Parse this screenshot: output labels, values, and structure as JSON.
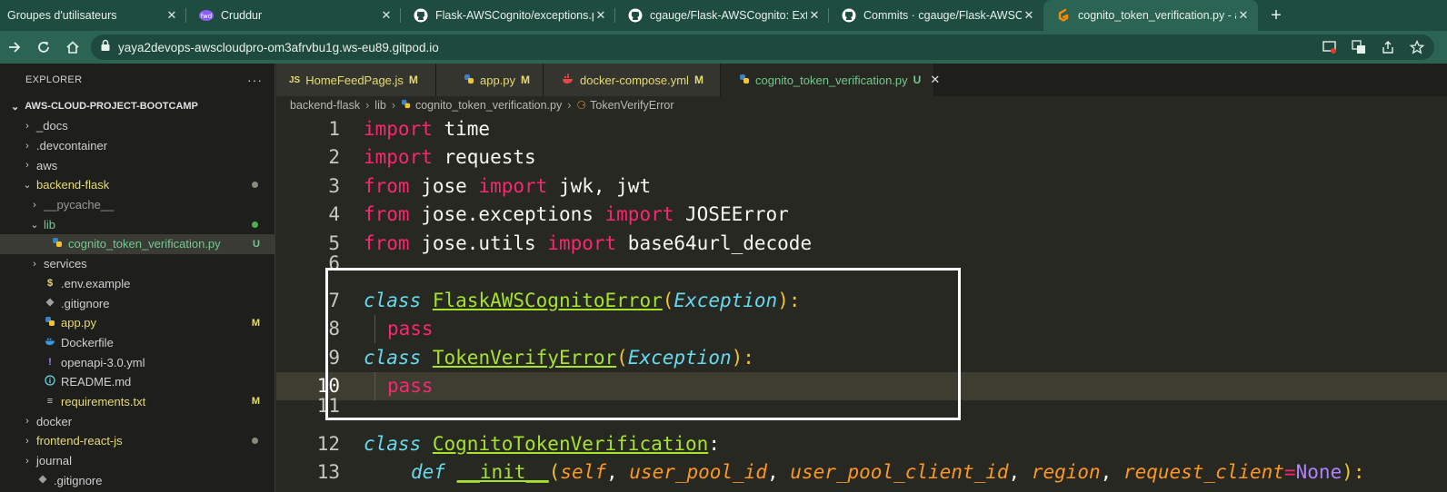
{
  "browser": {
    "tabs": [
      {
        "title": "Groupes d'utilisateurs",
        "icon": "none",
        "active": false
      },
      {
        "title": "Cruddur",
        "icon": "cruddur-icon",
        "active": false
      },
      {
        "title": "Flask-AWSCognito/exceptions.py",
        "icon": "github-icon",
        "active": false
      },
      {
        "title": "cgauge/Flask-AWSCognito: Exten",
        "icon": "github-icon",
        "active": false
      },
      {
        "title": "Commits · cgauge/Flask-AWSCog",
        "icon": "github-icon",
        "active": false
      },
      {
        "title": "cognito_token_verification.py - aw",
        "icon": "gitpod-icon",
        "active": true
      }
    ],
    "new_tab": "+",
    "url": "yaya2devops-awscloudpro-om3afrvbu1g.ws-eu89.gitpod.io"
  },
  "explorer": {
    "title": "EXPLORER",
    "more": "···",
    "project": "AWS-CLOUD-PROJECT-BOOTCAMP",
    "items": [
      {
        "label": "_docs",
        "chevron": "›",
        "icon": "",
        "badge": "",
        "dot": "",
        "color": "#cfcfcf",
        "indent": 24
      },
      {
        "label": ".devcontainer",
        "chevron": "›",
        "icon": "",
        "badge": "",
        "dot": "",
        "color": "#cfcfcf",
        "indent": 24
      },
      {
        "label": "aws",
        "chevron": "›",
        "icon": "",
        "badge": "",
        "dot": "",
        "color": "#cfcfcf",
        "indent": 24
      },
      {
        "label": "backend-flask",
        "chevron": "⌄",
        "icon": "",
        "badge": "",
        "dot": "#8a8a7a",
        "color": "#e6db74",
        "indent": 24
      },
      {
        "label": "__pycache__",
        "chevron": "›",
        "icon": "",
        "badge": "",
        "dot": "",
        "color": "#9a9a92",
        "indent": 32
      },
      {
        "label": "lib",
        "chevron": "⌄",
        "icon": "",
        "badge": "",
        "dot": "#4caf50",
        "color": "#73c991",
        "indent": 32
      },
      {
        "label": "cognito_token_verification.py",
        "chevron": "",
        "icon": "py",
        "badge": "U",
        "dot": "",
        "color": "#73c991",
        "indent": 40,
        "selected": true
      },
      {
        "label": "services",
        "chevron": "›",
        "icon": "",
        "badge": "",
        "dot": "",
        "color": "#cfcfcf",
        "indent": 32
      },
      {
        "label": ".env.example",
        "chevron": "",
        "icon": "$",
        "badge": "",
        "dot": "",
        "color": "#cfcfcf",
        "indent": 32
      },
      {
        "label": ".gitignore",
        "chevron": "",
        "icon": "git",
        "badge": "",
        "dot": "",
        "color": "#cfcfcf",
        "indent": 32
      },
      {
        "label": "app.py",
        "chevron": "",
        "icon": "py",
        "badge": "M",
        "dot": "",
        "color": "#e6db74",
        "indent": 32
      },
      {
        "label": "Dockerfile",
        "chevron": "",
        "icon": "docker",
        "badge": "",
        "dot": "",
        "color": "#cfcfcf",
        "indent": 32
      },
      {
        "label": "openapi-3.0.yml",
        "chevron": "",
        "icon": "!",
        "badge": "",
        "dot": "",
        "color": "#cfcfcf",
        "indent": 32
      },
      {
        "label": "README.md",
        "chevron": "",
        "icon": "i",
        "badge": "",
        "dot": "",
        "color": "#cfcfcf",
        "indent": 32
      },
      {
        "label": "requirements.txt",
        "chevron": "",
        "icon": "≡",
        "badge": "M",
        "dot": "",
        "color": "#e6db74",
        "indent": 32
      },
      {
        "label": "docker",
        "chevron": "›",
        "icon": "",
        "badge": "",
        "dot": "",
        "color": "#cfcfcf",
        "indent": 24
      },
      {
        "label": "frontend-react-js",
        "chevron": "›",
        "icon": "",
        "badge": "",
        "dot": "#8a8a7a",
        "color": "#e6db74",
        "indent": 24
      },
      {
        "label": "journal",
        "chevron": "›",
        "icon": "",
        "badge": "",
        "dot": "",
        "color": "#cfcfcf",
        "indent": 24
      },
      {
        "label": ".gitignore",
        "chevron": "",
        "icon": "git",
        "badge": "",
        "dot": "",
        "color": "#cfcfcf",
        "indent": 24
      }
    ]
  },
  "editor_tabs": [
    {
      "label": "HomeFeedPage.js",
      "icon": "JS",
      "status": "M",
      "color": "#e6db74",
      "active": false
    },
    {
      "label": "app.py",
      "icon": "py",
      "status": "M",
      "color": "#e6db74",
      "active": false
    },
    {
      "label": "docker-compose.yml",
      "icon": "docker",
      "status": "M",
      "color": "#e6db74",
      "active": false
    },
    {
      "label": "cognito_token_verification.py",
      "icon": "py",
      "status": "U",
      "color": "#73c991",
      "active": true
    }
  ],
  "tab_close": "✕",
  "breadcrumb": [
    "backend-flask",
    "lib",
    "cognito_token_verification.py",
    "TokenVerifyError"
  ],
  "code_lines": [
    {
      "n": "1"
    },
    {
      "n": "2"
    },
    {
      "n": "3"
    },
    {
      "n": "4"
    },
    {
      "n": "5"
    },
    {
      "n": "6"
    },
    {
      "n": "7"
    },
    {
      "n": "8"
    },
    {
      "n": "9"
    },
    {
      "n": "10"
    },
    {
      "n": "11"
    },
    {
      "n": "12"
    },
    {
      "n": "13"
    }
  ],
  "code_tokens": {
    "l1": [
      "import",
      " time"
    ],
    "l2": [
      "import",
      " requests"
    ],
    "l3": [
      "from",
      " jose ",
      "import",
      " jwk, jwt"
    ],
    "l4": [
      "from",
      " jose.exceptions ",
      "import",
      " JOSEError"
    ],
    "l5": [
      "from",
      " jose.utils ",
      "import",
      " base64url_decode"
    ],
    "l7": [
      "class",
      " ",
      "FlaskAWSCognitoError",
      "(",
      "Exception",
      "):"
    ],
    "l8": [
      "pass"
    ],
    "l9": [
      "class",
      " ",
      "TokenVerifyError",
      "(",
      "Exception",
      "):"
    ],
    "l10": [
      "pass"
    ],
    "l12": [
      "class",
      " ",
      "CognitoTokenVerification",
      ":"
    ],
    "l13": [
      "def",
      " ",
      "__init__",
      "(",
      "self",
      ", ",
      "user_pool_id",
      ", ",
      "user_pool_client_id",
      ", ",
      "region",
      ", ",
      "request_client",
      "=",
      "None",
      "):"
    ]
  },
  "colors": {
    "keyword": "#f92672",
    "class_keyword": "#66d9ef",
    "class_name": "#a6e22e",
    "param": "#fd971f",
    "constant": "#ae81ff",
    "browser_green": "#2b6452"
  }
}
